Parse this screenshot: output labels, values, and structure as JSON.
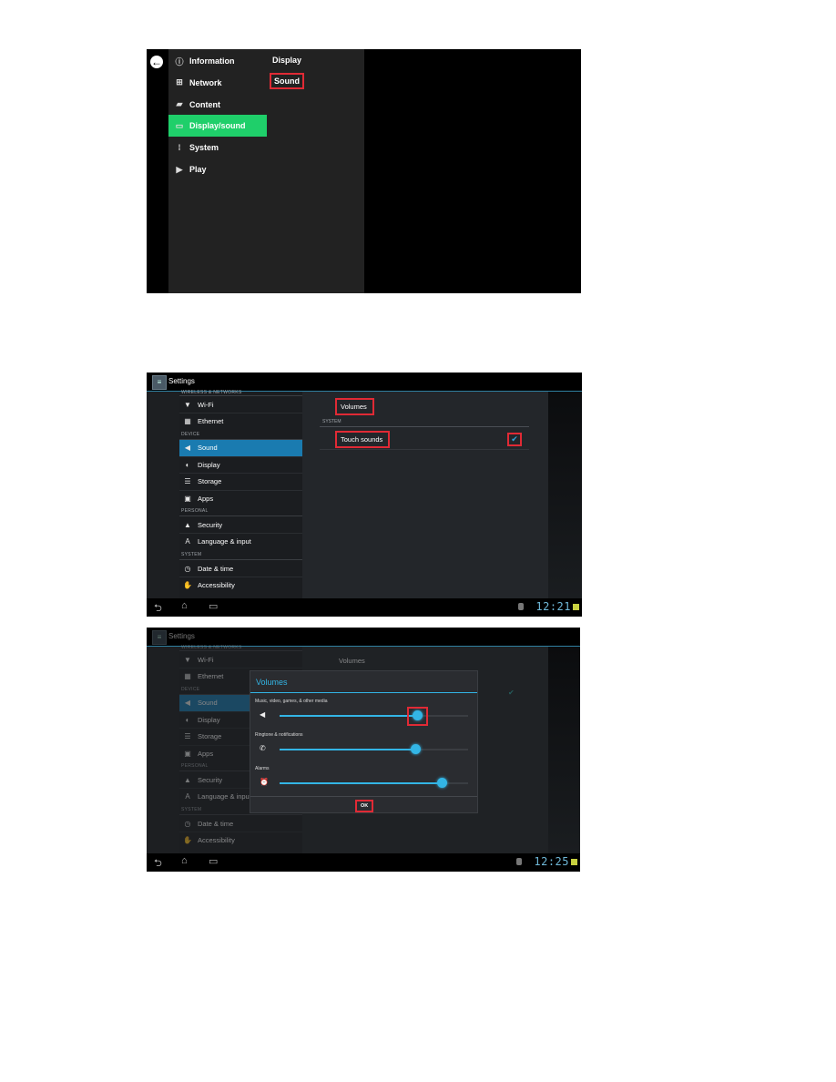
{
  "panel1": {
    "back_icon": "arrow-left-circle-icon",
    "menu": [
      {
        "label": "Information",
        "icon": "info-icon",
        "glyph": "ⓘ",
        "active": false
      },
      {
        "label": "Network",
        "icon": "network-icon",
        "glyph": "⊞",
        "active": false
      },
      {
        "label": "Content",
        "icon": "clapperboard-icon",
        "glyph": "▰",
        "active": false
      },
      {
        "label": "Display/sound",
        "icon": "monitor-icon",
        "glyph": "▭",
        "active": true
      },
      {
        "label": "System",
        "icon": "system-icon",
        "glyph": "⁞",
        "active": false
      },
      {
        "label": "Play",
        "icon": "play-icon",
        "glyph": "▶",
        "active": false
      }
    ],
    "submenu": [
      {
        "label": "Display",
        "highlighted": false
      },
      {
        "label": "Sound",
        "highlighted": true
      }
    ],
    "accent_color": "#1fcf6a",
    "highlight_color": "#e02a35"
  },
  "panel2": {
    "app_title": "Settings",
    "sidebar": {
      "top_header": "WIRELESS & NETWORKS",
      "sections": [
        {
          "header": null,
          "items": [
            {
              "label": "Wi-Fi",
              "icon": "wifi-icon",
              "glyph": "▼"
            },
            {
              "label": "Ethernet",
              "icon": "ethernet-icon",
              "glyph": "▦"
            }
          ]
        },
        {
          "header": "DEVICE",
          "items": [
            {
              "label": "Sound",
              "icon": "speaker-icon",
              "glyph": "◀",
              "selected": true
            },
            {
              "label": "Display",
              "icon": "display-icon",
              "glyph": "◐"
            },
            {
              "label": "Storage",
              "icon": "storage-icon",
              "glyph": "☰"
            },
            {
              "label": "Apps",
              "icon": "apps-icon",
              "glyph": "▣"
            }
          ]
        },
        {
          "header": "PERSONAL",
          "items": [
            {
              "label": "Security",
              "icon": "lock-icon",
              "glyph": "▲"
            },
            {
              "label": "Language & input",
              "icon": "keyboard-icon",
              "glyph": "A"
            }
          ]
        },
        {
          "header": "SYSTEM",
          "items": [
            {
              "label": "Date & time",
              "icon": "clock-icon",
              "glyph": "◷"
            },
            {
              "label": "Accessibility",
              "icon": "hand-icon",
              "glyph": "✋"
            }
          ]
        }
      ]
    },
    "content": {
      "volumes_label": "Volumes",
      "system_header": "SYSTEM",
      "touch_sounds_label": "Touch sounds",
      "touch_sounds_checked": true,
      "check_glyph": "✔"
    },
    "navbar": {
      "back": "⮌",
      "home": "⌂",
      "recents": "▭"
    },
    "clock": "12:21",
    "selected_color": "#1a7bb0"
  },
  "panel3": {
    "app_title": "Settings",
    "background_volumes_label": "Volumes",
    "dialog": {
      "title": "Volumes",
      "sliders": [
        {
          "label": "Music, video, games, & other media",
          "icon": "speaker-icon",
          "glyph": "◀",
          "value": 0.73,
          "highlighted": true
        },
        {
          "label": "Ringtone & notifications",
          "icon": "phone-ring-icon",
          "glyph": "✆",
          "value": 0.72,
          "highlighted": false
        },
        {
          "label": "Alarms",
          "icon": "alarm-clock-icon",
          "glyph": "⏰",
          "value": 0.86,
          "highlighted": false
        }
      ],
      "ok_label": "OK",
      "accent_color": "#33b5e5"
    },
    "clock": "12:25"
  }
}
